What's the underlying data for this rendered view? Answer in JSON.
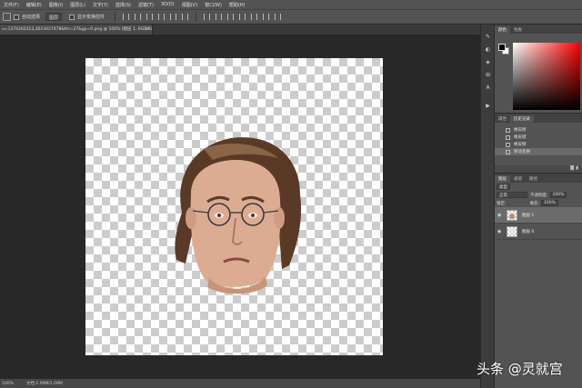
{
  "menu": [
    "文件(F)",
    "编辑(E)",
    "图像(I)",
    "图层(L)",
    "文字(Y)",
    "选择(S)",
    "滤镜(T)",
    "3D(D)",
    "视图(V)",
    "窗口(W)",
    "帮助(H)"
  ],
  "options": {
    "auto_select": "自动选择",
    "layer_select": "图层",
    "show_transform": "显示变换控件"
  },
  "tab": {
    "title": "u=1376262313,3023427478&fm=27&gp=0.png @ 100% (图层 1, RGB/8)",
    "close": "×"
  },
  "status": {
    "zoom": "100%",
    "doc": "文档:1.09M/1.09M"
  },
  "color_panel": {
    "tabs": [
      "颜色",
      "色板"
    ],
    "fg": "#000000",
    "bg": "#ffffff"
  },
  "history_panel": {
    "tabs": [
      "属性",
      "历史记录"
    ],
    "items": [
      "橡皮擦",
      "橡皮擦",
      "橡皮擦",
      "移动变换"
    ]
  },
  "layers_panel": {
    "tabs": [
      "图层",
      "通道",
      "路径"
    ],
    "kind": "类型",
    "blend_mode": "正常",
    "opacity_label": "不透明度:",
    "opacity": "100%",
    "lock_label": "锁定:",
    "fill_label": "填充:",
    "fill": "100%",
    "layers": [
      {
        "name": "图层 1",
        "selected": true
      },
      {
        "name": "图层 0",
        "selected": false
      }
    ]
  },
  "watermark": "头条 @灵就宫"
}
